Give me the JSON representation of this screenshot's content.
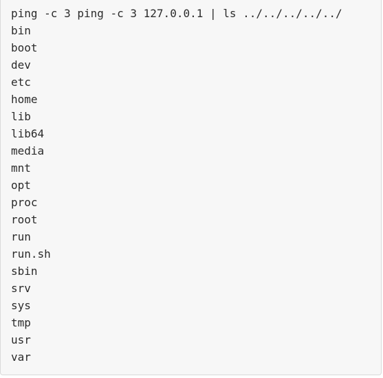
{
  "terminal": {
    "command": "ping -c 3 ping -c 3 127.0.0.1 | ls ../../../../../",
    "entries": [
      "bin",
      "boot",
      "dev",
      "etc",
      "home",
      "lib",
      "lib64",
      "media",
      "mnt",
      "opt",
      "proc",
      "root",
      "run",
      "run.sh",
      "sbin",
      "srv",
      "sys",
      "tmp",
      "usr",
      "var"
    ]
  }
}
